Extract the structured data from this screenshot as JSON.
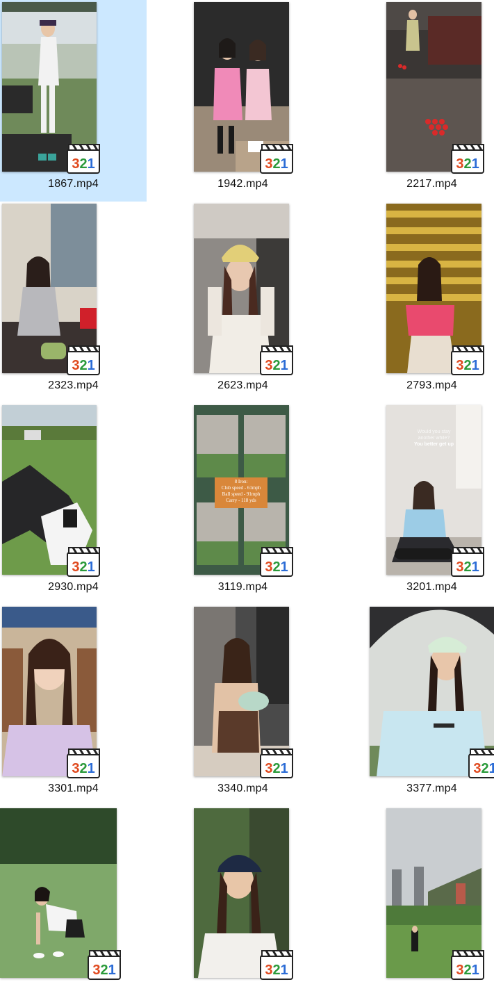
{
  "files": [
    {
      "name": "1867.mp4",
      "selected": true
    },
    {
      "name": "1942.mp4"
    },
    {
      "name": "2217.mp4"
    },
    {
      "name": "2323.mp4"
    },
    {
      "name": "2623.mp4"
    },
    {
      "name": "2793.mp4"
    },
    {
      "name": "2930.mp4"
    },
    {
      "name": "3119.mp4",
      "overlay_text": [
        "8 Iron:",
        "Club speed - 61mph",
        "Ball speed - 91mph",
        "Carry - 118 yds"
      ]
    },
    {
      "name": "3201.mp4",
      "overlay_text": [
        "Would you stay",
        "another while?",
        "You better get up"
      ]
    },
    {
      "name": "3301.mp4"
    },
    {
      "name": "3340.mp4"
    },
    {
      "name": "3377.mp4"
    },
    {
      "name": "",
      "partial": true
    },
    {
      "name": "",
      "partial": true
    },
    {
      "name": "",
      "partial": true
    }
  ],
  "badge": {
    "text": "321",
    "icon": "media-player-classic-icon"
  },
  "colors": {
    "selection": "#cce8ff",
    "label": "#111111"
  }
}
